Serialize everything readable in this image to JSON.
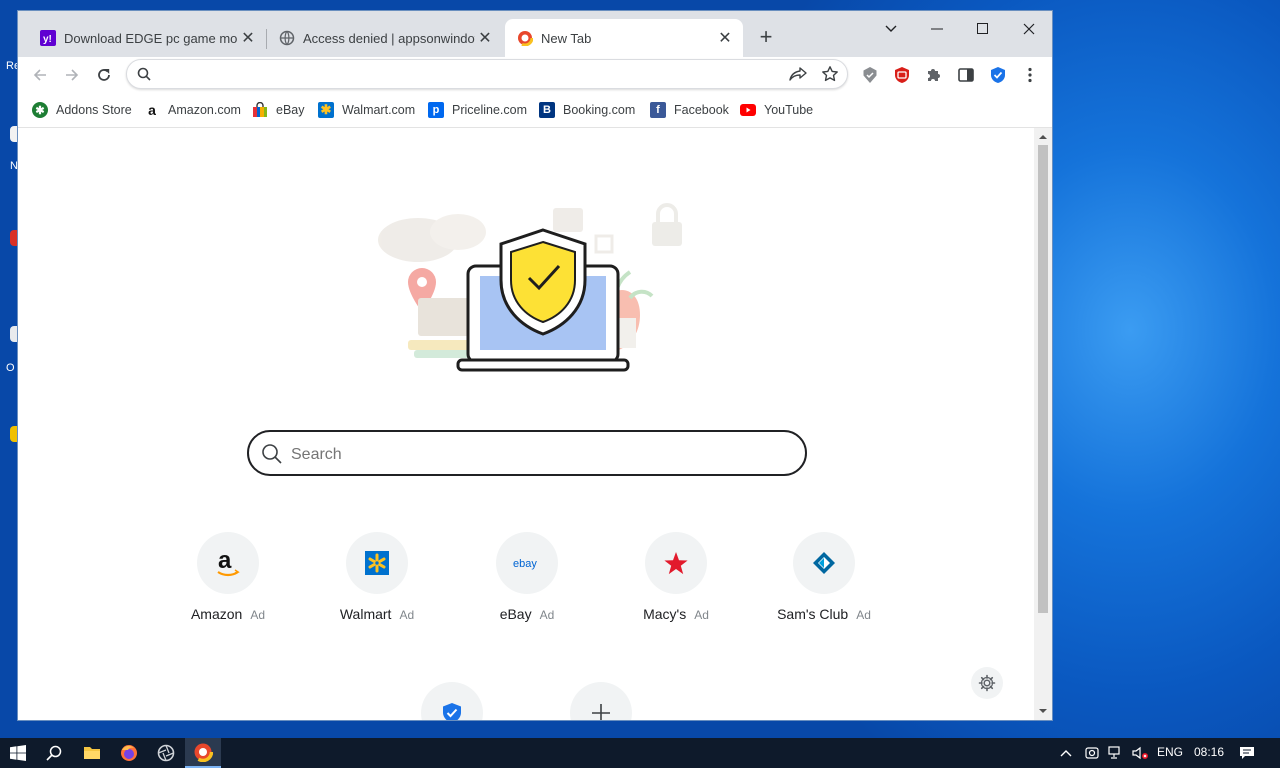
{
  "colors": {
    "accent": "#1a73e8",
    "taskbar": "#0e1a2b",
    "titlebar": "#dee1e6",
    "shield_yellow": "#fde135",
    "macys_red": "#e21a2c",
    "walmart_blue": "#0071ce",
    "walmart_yellow": "#ffc220"
  },
  "desktop": {
    "fragments": [
      "Re",
      "N",
      "",
      "O",
      ""
    ]
  },
  "tabs": [
    {
      "title": "Download EDGE pc game mobig",
      "icon": "yahoo-icon"
    },
    {
      "title": "Access denied | appsonwindows",
      "icon": "globe-icon"
    },
    {
      "title": "New Tab",
      "icon": "browser-logo-icon",
      "active": true
    }
  ],
  "omnibox": {
    "placeholder": "",
    "value": ""
  },
  "bookmarks": [
    {
      "label": "Addons Store",
      "icon": "addons-store-icon"
    },
    {
      "label": "Amazon.com",
      "icon": "amazon-icon"
    },
    {
      "label": "eBay",
      "icon": "ebay-bag-icon"
    },
    {
      "label": "Walmart.com",
      "icon": "walmart-icon"
    },
    {
      "label": "Priceline.com",
      "icon": "priceline-icon"
    },
    {
      "label": "Booking.com",
      "icon": "booking-icon"
    },
    {
      "label": "Facebook",
      "icon": "facebook-icon"
    },
    {
      "label": "YouTube",
      "icon": "youtube-icon"
    }
  ],
  "newtab": {
    "search_placeholder": "Search",
    "tiles": [
      {
        "label": "Amazon",
        "ad": "Ad",
        "icon": "amazon-logo-icon",
        "logo_text": "a"
      },
      {
        "label": "Walmart",
        "ad": "Ad",
        "icon": "walmart-spark-icon"
      },
      {
        "label": "eBay",
        "ad": "Ad",
        "icon": "ebay-logo-icon",
        "logo_text": "ebay"
      },
      {
        "label": "Macy's",
        "ad": "Ad",
        "icon": "macys-star-icon"
      },
      {
        "label": "Sam's Club",
        "ad": "Ad",
        "icon": "sams-club-icon"
      }
    ]
  },
  "taskbar": {
    "language": "ENG",
    "time": "08:16"
  }
}
